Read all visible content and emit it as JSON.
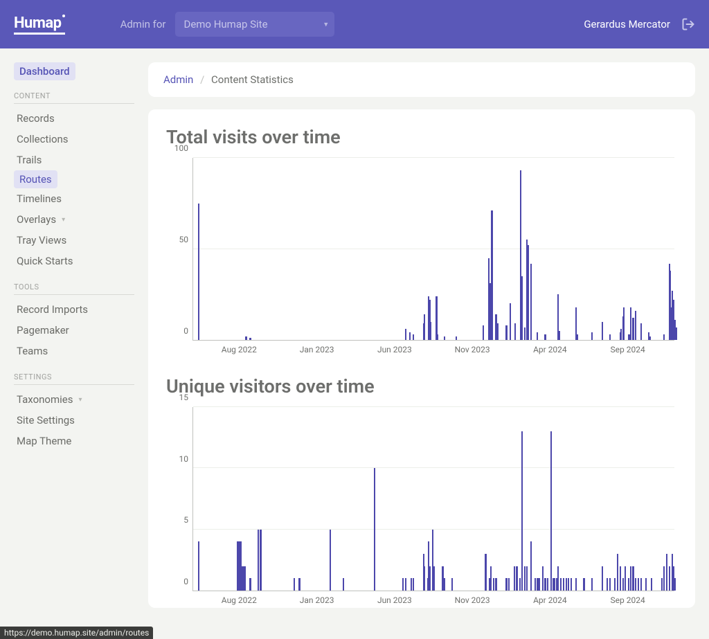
{
  "header": {
    "logo": "Humap",
    "admin_for_label": "Admin for",
    "site_selected": "Demo Humap Site",
    "user_name": "Gerardus Mercator"
  },
  "sidebar": {
    "dashboard": "Dashboard",
    "groups": [
      {
        "title": "CONTENT",
        "items": [
          {
            "label": "Records",
            "active": false,
            "caret": false
          },
          {
            "label": "Collections",
            "active": false,
            "caret": false
          },
          {
            "label": "Trails",
            "active": false,
            "caret": false
          },
          {
            "label": "Routes",
            "active": false,
            "caret": false,
            "hover": true
          },
          {
            "label": "Timelines",
            "active": false,
            "caret": false
          },
          {
            "label": "Overlays",
            "active": false,
            "caret": true
          },
          {
            "label": "Tray Views",
            "active": false,
            "caret": false
          },
          {
            "label": "Quick Starts",
            "active": false,
            "caret": false
          }
        ]
      },
      {
        "title": "TOOLS",
        "items": [
          {
            "label": "Record Imports"
          },
          {
            "label": "Pagemaker"
          },
          {
            "label": "Teams"
          }
        ]
      },
      {
        "title": "SETTINGS",
        "items": [
          {
            "label": "Taxonomies",
            "caret": true
          },
          {
            "label": "Site Settings"
          },
          {
            "label": "Map Theme"
          }
        ]
      }
    ]
  },
  "breadcrumb": {
    "root": "Admin",
    "current": "Content Statistics"
  },
  "chart_data": [
    {
      "type": "bar",
      "title": "Total visits over time",
      "xlabel": "",
      "ylabel": "",
      "ylim": [
        0,
        100
      ],
      "y_ticks": [
        0,
        50,
        100
      ],
      "x_ticks": [
        "Aug 2022",
        "Jan 2023",
        "Jun 2023",
        "Nov 2023",
        "Apr 2024",
        "Sep 2024"
      ],
      "x_range_months": [
        "2022-05",
        "2024-12"
      ],
      "series": [
        {
          "name": "visits",
          "points": [
            {
              "x": "2022-05-10",
              "v": 75
            },
            {
              "x": "2022-08-12",
              "v": 2
            },
            {
              "x": "2022-08-20",
              "v": 1
            },
            {
              "x": "2023-06-20",
              "v": 6
            },
            {
              "x": "2023-06-28",
              "v": 4
            },
            {
              "x": "2023-07-05",
              "v": 3
            },
            {
              "x": "2023-07-25",
              "v": 9
            },
            {
              "x": "2023-07-27",
              "v": 14
            },
            {
              "x": "2023-08-05",
              "v": 24
            },
            {
              "x": "2023-08-07",
              "v": 22
            },
            {
              "x": "2023-08-09",
              "v": 10
            },
            {
              "x": "2023-08-20",
              "v": 24
            },
            {
              "x": "2023-08-22",
              "v": 3
            },
            {
              "x": "2023-09-05",
              "v": 2
            },
            {
              "x": "2023-09-28",
              "v": 2
            },
            {
              "x": "2023-11-20",
              "v": 8
            },
            {
              "x": "2023-12-01",
              "v": 45
            },
            {
              "x": "2023-12-03",
              "v": 31
            },
            {
              "x": "2023-12-07",
              "v": 71
            },
            {
              "x": "2023-12-15",
              "v": 14
            },
            {
              "x": "2023-12-18",
              "v": 9
            },
            {
              "x": "2024-01-05",
              "v": 8
            },
            {
              "x": "2024-01-12",
              "v": 20
            },
            {
              "x": "2024-01-22",
              "v": 9
            },
            {
              "x": "2024-02-02",
              "v": 93
            },
            {
              "x": "2024-02-05",
              "v": 35
            },
            {
              "x": "2024-02-10",
              "v": 7
            },
            {
              "x": "2024-02-15",
              "v": 55
            },
            {
              "x": "2024-02-17",
              "v": 52
            },
            {
              "x": "2024-02-22",
              "v": 42
            },
            {
              "x": "2024-03-05",
              "v": 4
            },
            {
              "x": "2024-03-20",
              "v": 3
            },
            {
              "x": "2024-04-15",
              "v": 25
            },
            {
              "x": "2024-04-17",
              "v": 5
            },
            {
              "x": "2024-05-20",
              "v": 18
            },
            {
              "x": "2024-05-22",
              "v": 3
            },
            {
              "x": "2024-06-20",
              "v": 4
            },
            {
              "x": "2024-07-10",
              "v": 10
            },
            {
              "x": "2024-07-25",
              "v": 3
            },
            {
              "x": "2024-08-15",
              "v": 4
            },
            {
              "x": "2024-08-16",
              "v": 6
            },
            {
              "x": "2024-08-20",
              "v": 13
            },
            {
              "x": "2024-08-22",
              "v": 18
            },
            {
              "x": "2024-09-02",
              "v": 3
            },
            {
              "x": "2024-09-05",
              "v": 18
            },
            {
              "x": "2024-09-10",
              "v": 12
            },
            {
              "x": "2024-09-15",
              "v": 16
            },
            {
              "x": "2024-09-25",
              "v": 9
            },
            {
              "x": "2024-10-10",
              "v": 4
            },
            {
              "x": "2024-10-12",
              "v": 2
            },
            {
              "x": "2024-11-10",
              "v": 3
            },
            {
              "x": "2024-11-20",
              "v": 42
            },
            {
              "x": "2024-11-22",
              "v": 38
            },
            {
              "x": "2024-11-24",
              "v": 18
            },
            {
              "x": "2024-11-26",
              "v": 27
            },
            {
              "x": "2024-11-28",
              "v": 22
            },
            {
              "x": "2024-12-01",
              "v": 11
            },
            {
              "x": "2024-12-03",
              "v": 7
            }
          ]
        }
      ]
    },
    {
      "type": "bar",
      "title": "Unique visitors over time",
      "xlabel": "",
      "ylabel": "",
      "ylim": [
        0,
        15
      ],
      "y_ticks": [
        0,
        5,
        10,
        15
      ],
      "x_ticks": [
        "Aug 2022",
        "Jan 2023",
        "Jun 2023",
        "Nov 2023",
        "Apr 2024",
        "Sep 2024"
      ],
      "x_range_months": [
        "2022-05",
        "2024-12"
      ],
      "series": [
        {
          "name": "unique",
          "points": [
            {
              "x": "2022-05-10",
              "v": 4
            },
            {
              "x": "2022-07-25",
              "v": 4
            },
            {
              "x": "2022-07-27",
              "v": 4
            },
            {
              "x": "2022-07-29",
              "v": 4
            },
            {
              "x": "2022-07-31",
              "v": 3
            },
            {
              "x": "2022-08-02",
              "v": 4
            },
            {
              "x": "2022-08-04",
              "v": 2
            },
            {
              "x": "2022-08-06",
              "v": 2
            },
            {
              "x": "2022-08-08",
              "v": 2
            },
            {
              "x": "2022-08-10",
              "v": 2
            },
            {
              "x": "2022-08-20",
              "v": 1
            },
            {
              "x": "2022-09-05",
              "v": 5
            },
            {
              "x": "2022-09-10",
              "v": 5
            },
            {
              "x": "2022-11-15",
              "v": 1
            },
            {
              "x": "2022-11-25",
              "v": 1
            },
            {
              "x": "2023-01-25",
              "v": 5
            },
            {
              "x": "2023-02-20",
              "v": 1
            },
            {
              "x": "2023-04-20",
              "v": 10
            },
            {
              "x": "2023-06-15",
              "v": 1
            },
            {
              "x": "2023-06-20",
              "v": 1
            },
            {
              "x": "2023-07-01",
              "v": 1
            },
            {
              "x": "2023-07-05",
              "v": 1
            },
            {
              "x": "2023-07-25",
              "v": 3
            },
            {
              "x": "2023-07-27",
              "v": 2
            },
            {
              "x": "2023-08-03",
              "v": 1
            },
            {
              "x": "2023-08-05",
              "v": 4
            },
            {
              "x": "2023-08-07",
              "v": 2
            },
            {
              "x": "2023-08-12",
              "v": 5
            },
            {
              "x": "2023-08-15",
              "v": 2
            },
            {
              "x": "2023-09-02",
              "v": 2
            },
            {
              "x": "2023-09-05",
              "v": 1
            },
            {
              "x": "2023-09-20",
              "v": 1
            },
            {
              "x": "2023-11-25",
              "v": 3
            },
            {
              "x": "2023-12-02",
              "v": 1
            },
            {
              "x": "2023-12-05",
              "v": 2
            },
            {
              "x": "2023-12-10",
              "v": 1
            },
            {
              "x": "2023-12-15",
              "v": 1
            },
            {
              "x": "2024-01-05",
              "v": 1
            },
            {
              "x": "2024-01-10",
              "v": 1
            },
            {
              "x": "2024-01-20",
              "v": 2
            },
            {
              "x": "2024-01-25",
              "v": 2
            },
            {
              "x": "2024-02-01",
              "v": 1
            },
            {
              "x": "2024-02-05",
              "v": 13
            },
            {
              "x": "2024-02-10",
              "v": 2
            },
            {
              "x": "2024-02-15",
              "v": 2
            },
            {
              "x": "2024-02-22",
              "v": 4
            },
            {
              "x": "2024-03-01",
              "v": 1
            },
            {
              "x": "2024-03-05",
              "v": 1
            },
            {
              "x": "2024-03-08",
              "v": 1
            },
            {
              "x": "2024-03-15",
              "v": 2
            },
            {
              "x": "2024-03-20",
              "v": 1
            },
            {
              "x": "2024-03-25",
              "v": 1
            },
            {
              "x": "2024-04-01",
              "v": 13
            },
            {
              "x": "2024-04-05",
              "v": 1
            },
            {
              "x": "2024-04-08",
              "v": 1
            },
            {
              "x": "2024-04-12",
              "v": 1
            },
            {
              "x": "2024-04-15",
              "v": 2
            },
            {
              "x": "2024-04-20",
              "v": 1
            },
            {
              "x": "2024-04-25",
              "v": 1
            },
            {
              "x": "2024-05-01",
              "v": 1
            },
            {
              "x": "2024-05-05",
              "v": 1
            },
            {
              "x": "2024-05-10",
              "v": 1
            },
            {
              "x": "2024-05-20",
              "v": 1
            },
            {
              "x": "2024-06-05",
              "v": 1
            },
            {
              "x": "2024-06-20",
              "v": 1
            },
            {
              "x": "2024-07-10",
              "v": 2
            },
            {
              "x": "2024-07-20",
              "v": 1
            },
            {
              "x": "2024-07-25",
              "v": 1
            },
            {
              "x": "2024-08-05",
              "v": 1
            },
            {
              "x": "2024-08-10",
              "v": 3
            },
            {
              "x": "2024-08-15",
              "v": 2
            },
            {
              "x": "2024-08-20",
              "v": 1
            },
            {
              "x": "2024-08-25",
              "v": 2
            },
            {
              "x": "2024-09-01",
              "v": 1
            },
            {
              "x": "2024-09-05",
              "v": 2
            },
            {
              "x": "2024-09-10",
              "v": 2
            },
            {
              "x": "2024-09-15",
              "v": 1
            },
            {
              "x": "2024-09-20",
              "v": 1
            },
            {
              "x": "2024-09-25",
              "v": 1
            },
            {
              "x": "2024-10-05",
              "v": 1
            },
            {
              "x": "2024-10-15",
              "v": 1
            },
            {
              "x": "2024-11-05",
              "v": 1
            },
            {
              "x": "2024-11-10",
              "v": 2
            },
            {
              "x": "2024-11-15",
              "v": 3
            },
            {
              "x": "2024-11-20",
              "v": 2
            },
            {
              "x": "2024-11-25",
              "v": 3
            },
            {
              "x": "2024-11-28",
              "v": 2
            },
            {
              "x": "2024-12-01",
              "v": 1
            }
          ]
        }
      ]
    }
  ],
  "status_url": "https://demo.humap.site/admin/routes"
}
